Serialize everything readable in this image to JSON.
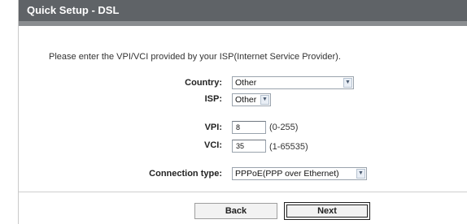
{
  "title": "Quick Setup - DSL",
  "instruction": "Please enter the VPI/VCI provided by your ISP(Internet Service Provider).",
  "country": {
    "label": "Country:",
    "value": "Other"
  },
  "isp": {
    "label": "ISP:",
    "value": "Other"
  },
  "vpi": {
    "label": "VPI:",
    "value": "8",
    "range": "(0-255)"
  },
  "vci": {
    "label": "VCI:",
    "value": "35",
    "range": "(1-65535)"
  },
  "connection_type": {
    "label": "Connection type:",
    "value": "PPPoE(PPP over Ethernet)"
  },
  "buttons": {
    "back": "Back",
    "next": "Next"
  }
}
